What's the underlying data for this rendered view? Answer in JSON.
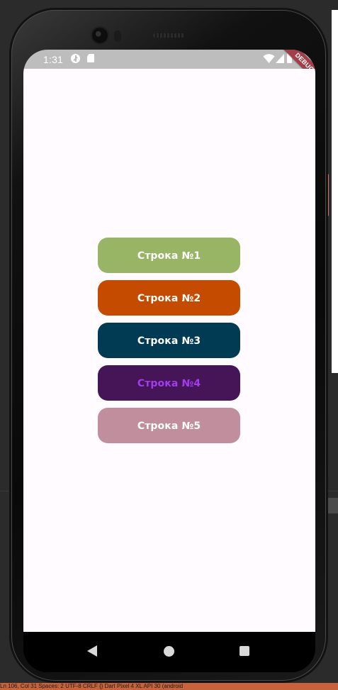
{
  "status_bar": {
    "time": "1:31",
    "icons": [
      "data-saver-icon",
      "sd-card-icon",
      "wifi-icon",
      "signal-icon",
      "battery-icon"
    ],
    "background": "#BDBDBD"
  },
  "debug_banner": {
    "label": "DEBUG",
    "color": "#A33F4B"
  },
  "app": {
    "background": "#FFFBFE",
    "buttons": [
      {
        "label": "Строка №1",
        "color": "#98B566",
        "text_color": "#FFFFFF"
      },
      {
        "label": "Строка №2",
        "color": "#C54B00",
        "text_color": "#FFFFFF"
      },
      {
        "label": "Строка №3",
        "color": "#003B53",
        "text_color": "#FFFFFF"
      },
      {
        "label": "Строка №4",
        "color": "#451558",
        "text_color": "#A33CF0"
      },
      {
        "label": "Строка №5",
        "color": "#C08E9C",
        "text_color": "#FFFFFF"
      }
    ]
  },
  "navigation": {
    "buttons": [
      "back-icon",
      "home-icon",
      "recents-icon"
    ]
  },
  "ide": {
    "status_text": "Ln 106, Col 31   Spaces: 2   UTF-8   CRLF   {}  Dart   Pixel 4 XL API 30 (android"
  }
}
